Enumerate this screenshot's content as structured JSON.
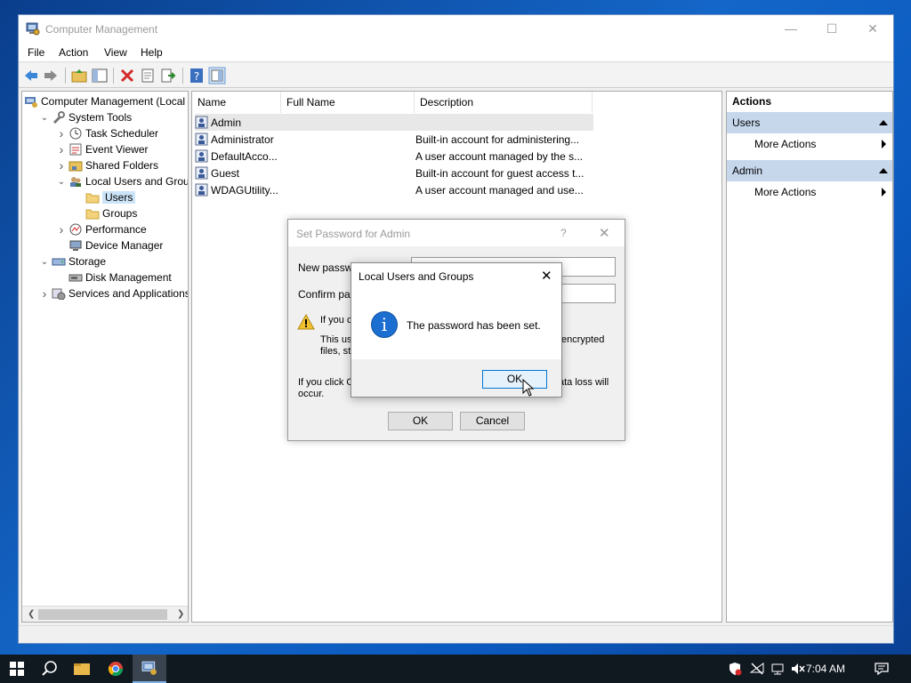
{
  "window": {
    "title": "Computer Management",
    "menu": [
      "File",
      "Action",
      "View",
      "Help"
    ]
  },
  "tree": [
    {
      "label": "Computer Management (Local",
      "indent": 0,
      "arrow": "",
      "icon": "computer-management-icon"
    },
    {
      "label": "System Tools",
      "indent": 1,
      "arrow": "expanded",
      "icon": "tools-icon"
    },
    {
      "label": "Task Scheduler",
      "indent": 2,
      "arrow": "collapsed",
      "icon": "clock-icon"
    },
    {
      "label": "Event Viewer",
      "indent": 2,
      "arrow": "collapsed",
      "icon": "event-viewer-icon"
    },
    {
      "label": "Shared Folders",
      "indent": 2,
      "arrow": "collapsed",
      "icon": "shared-folder-icon"
    },
    {
      "label": "Local Users and Groups",
      "indent": 2,
      "arrow": "expanded",
      "icon": "users-icon"
    },
    {
      "label": "Users",
      "indent": 3,
      "arrow": "",
      "icon": "folder-icon",
      "selected": true
    },
    {
      "label": "Groups",
      "indent": 3,
      "arrow": "",
      "icon": "folder-icon"
    },
    {
      "label": "Performance",
      "indent": 2,
      "arrow": "collapsed",
      "icon": "performance-icon"
    },
    {
      "label": "Device Manager",
      "indent": 2,
      "arrow": "",
      "icon": "device-manager-icon"
    },
    {
      "label": "Storage",
      "indent": 1,
      "arrow": "expanded",
      "icon": "storage-icon"
    },
    {
      "label": "Disk Management",
      "indent": 2,
      "arrow": "",
      "icon": "disk-icon"
    },
    {
      "label": "Services and Applications",
      "indent": 1,
      "arrow": "collapsed",
      "icon": "services-icon"
    }
  ],
  "list": {
    "columns": [
      "Name",
      "Full Name",
      "Description"
    ],
    "rows": [
      {
        "name": "Admin",
        "full_name": "",
        "description": ""
      },
      {
        "name": "Administrator",
        "full_name": "",
        "description": "Built-in account for administering..."
      },
      {
        "name": "DefaultAcco...",
        "full_name": "",
        "description": "A user account managed by the s..."
      },
      {
        "name": "Guest",
        "full_name": "",
        "description": "Built-in account for guest access t..."
      },
      {
        "name": "WDAGUtility...",
        "full_name": "",
        "description": "A user account managed and use..."
      }
    ]
  },
  "actions": {
    "header": "Actions",
    "groups": [
      {
        "title": "Users",
        "item": "More Actions"
      },
      {
        "title": "Admin",
        "item": "More Actions"
      }
    ]
  },
  "set_password_dialog": {
    "title": "Set Password for Admin",
    "help": "?",
    "new_password_label": "New passwo",
    "confirm_password_label": "Confirm pass",
    "warning_line1": "If you c",
    "warning_line2": "This us",
    "warning_line2_right": "encrypted",
    "warning_line3": "files, sto",
    "footer_line1_left": "If you click O",
    "footer_line1_right": "ata loss will",
    "footer_line2": "occur.",
    "ok": "OK",
    "cancel": "Cancel"
  },
  "message_box": {
    "title": "Local Users and Groups",
    "message": "The password has been set.",
    "icon_glyph": "i",
    "ok": "OK"
  },
  "taskbar": {
    "time": "7:04 AM"
  },
  "colors": {
    "accent": "#0078d7",
    "selection": "#cce4f7",
    "actions_group": "#c6d7ec"
  }
}
